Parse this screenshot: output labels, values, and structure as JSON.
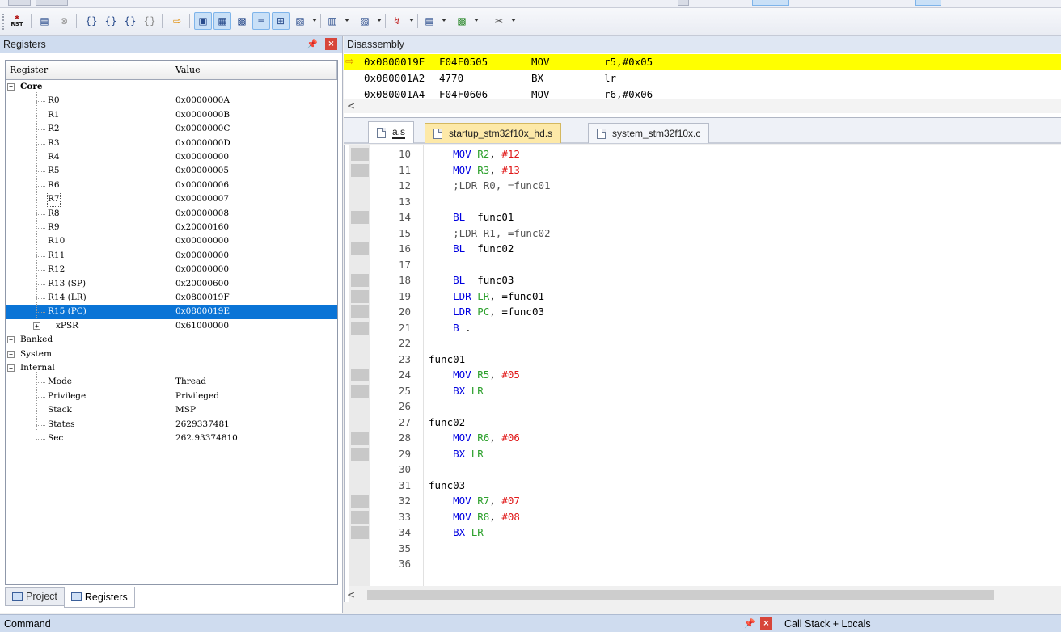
{
  "panels": {
    "registers_title": "Registers",
    "disassembly_title": "Disassembly",
    "command_title": "Command",
    "callstack_title": "Call Stack + Locals"
  },
  "registers": {
    "col_register": "Register",
    "col_value": "Value",
    "rows": [
      {
        "name": "Core",
        "value": "",
        "bold": true
      },
      {
        "name": "R0",
        "value": "0x0000000A"
      },
      {
        "name": "R1",
        "value": "0x0000000B"
      },
      {
        "name": "R2",
        "value": "0x0000000C"
      },
      {
        "name": "R3",
        "value": "0x0000000D"
      },
      {
        "name": "R4",
        "value": "0x00000000"
      },
      {
        "name": "R5",
        "value": "0x00000005"
      },
      {
        "name": "R6",
        "value": "0x00000006"
      },
      {
        "name": "R7",
        "value": "0x00000007",
        "focus": true
      },
      {
        "name": "R8",
        "value": "0x00000008"
      },
      {
        "name": "R9",
        "value": "0x20000160"
      },
      {
        "name": "R10",
        "value": "0x00000000"
      },
      {
        "name": "R11",
        "value": "0x00000000"
      },
      {
        "name": "R12",
        "value": "0x00000000"
      },
      {
        "name": "R13 (SP)",
        "value": "0x20000600"
      },
      {
        "name": "R14 (LR)",
        "value": "0x0800019F"
      },
      {
        "name": "R15 (PC)",
        "value": "0x0800019E",
        "selected": true
      },
      {
        "name": "xPSR",
        "value": "0x61000000",
        "expandable": true
      },
      {
        "name": "Banked",
        "value": "",
        "expandable": true
      },
      {
        "name": "System",
        "value": "",
        "expandable": true
      },
      {
        "name": "Internal",
        "value": "",
        "expanded": true
      },
      {
        "name": "Mode",
        "value": "Thread"
      },
      {
        "name": "Privilege",
        "value": "Privileged"
      },
      {
        "name": "Stack",
        "value": "MSP"
      },
      {
        "name": "States",
        "value": "2629337481"
      },
      {
        "name": "Sec",
        "value": "262.93374810"
      }
    ]
  },
  "bottom_tabs": [
    {
      "label": "Project",
      "active": false
    },
    {
      "label": "Registers",
      "active": true
    }
  ],
  "disassembly": {
    "lines": [
      {
        "addr": "0x0800019E",
        "opcode": "F04F0505",
        "mnem": "MOV",
        "operands": "r5,#0x05",
        "current": true
      },
      {
        "addr": "0x080001A2",
        "opcode": "4770",
        "mnem": "BX",
        "operands": "lr",
        "current": false
      },
      {
        "addr": "0x080001A4",
        "opcode": "F04F0606",
        "mnem": "MOV",
        "operands": "r6,#0x06",
        "current": false
      }
    ]
  },
  "editor_tabs": [
    {
      "label": "a.s",
      "active": true,
      "highlight": false
    },
    {
      "label": "startup_stm32f10x_hd.s",
      "active": false,
      "highlight": true
    },
    {
      "label": "system_stm32f10x.c",
      "active": false,
      "highlight": false
    }
  ],
  "code": {
    "lines": [
      {
        "n": "10",
        "parts": [
          [
            "i",
            "    "
          ],
          [
            "kw",
            "MOV"
          ],
          [
            "i",
            " "
          ],
          [
            "rg",
            "R2"
          ],
          [
            "i",
            ", "
          ],
          [
            "nm",
            "#12"
          ]
        ],
        "bp": true
      },
      {
        "n": "11",
        "parts": [
          [
            "i",
            "    "
          ],
          [
            "kw",
            "MOV"
          ],
          [
            "i",
            " "
          ],
          [
            "rg",
            "R3"
          ],
          [
            "i",
            ", "
          ],
          [
            "nm",
            "#13"
          ]
        ],
        "bp": true
      },
      {
        "n": "12",
        "parts": [
          [
            "i",
            "    "
          ],
          [
            "cm",
            ";LDR R0, =func01"
          ]
        ],
        "bp": false
      },
      {
        "n": "13",
        "parts": [],
        "bp": false
      },
      {
        "n": "14",
        "parts": [
          [
            "i",
            "    "
          ],
          [
            "kw",
            "BL"
          ],
          [
            "lb",
            "  func01"
          ]
        ],
        "bp": true
      },
      {
        "n": "15",
        "parts": [
          [
            "i",
            "    "
          ],
          [
            "cm",
            ";LDR R1, =func02"
          ]
        ],
        "bp": false
      },
      {
        "n": "16",
        "parts": [
          [
            "i",
            "    "
          ],
          [
            "kw",
            "BL"
          ],
          [
            "lb",
            "  func02"
          ]
        ],
        "bp": true
      },
      {
        "n": "17",
        "parts": [],
        "bp": false
      },
      {
        "n": "18",
        "parts": [
          [
            "i",
            "    "
          ],
          [
            "kw",
            "BL"
          ],
          [
            "lb",
            "  func03"
          ]
        ],
        "bp": true
      },
      {
        "n": "19",
        "parts": [
          [
            "i",
            "    "
          ],
          [
            "kw",
            "LDR"
          ],
          [
            "i",
            " "
          ],
          [
            "rg",
            "LR"
          ],
          [
            "lb",
            ", =func01"
          ]
        ],
        "bp": true
      },
      {
        "n": "20",
        "parts": [
          [
            "i",
            "    "
          ],
          [
            "kw",
            "LDR"
          ],
          [
            "i",
            " "
          ],
          [
            "rg",
            "PC"
          ],
          [
            "lb",
            ", =func03"
          ]
        ],
        "bp": true
      },
      {
        "n": "21",
        "parts": [
          [
            "i",
            "    "
          ],
          [
            "kw",
            "B"
          ],
          [
            "lb",
            " ."
          ]
        ],
        "bp": true
      },
      {
        "n": "22",
        "parts": [],
        "bp": false
      },
      {
        "n": "23",
        "parts": [
          [
            "lb",
            "func01"
          ]
        ],
        "bp": false
      },
      {
        "n": "24",
        "parts": [
          [
            "i",
            "    "
          ],
          [
            "kw",
            "MOV"
          ],
          [
            "i",
            " "
          ],
          [
            "rg",
            "R5"
          ],
          [
            "i",
            ", "
          ],
          [
            "nm",
            "#05"
          ]
        ],
        "bp": true
      },
      {
        "n": "25",
        "parts": [
          [
            "i",
            "    "
          ],
          [
            "kw",
            "BX"
          ],
          [
            "i",
            " "
          ],
          [
            "rg",
            "LR"
          ]
        ],
        "bp": true
      },
      {
        "n": "26",
        "parts": [],
        "bp": false
      },
      {
        "n": "27",
        "parts": [
          [
            "lb",
            "func02"
          ]
        ],
        "bp": false
      },
      {
        "n": "28",
        "parts": [
          [
            "i",
            "    "
          ],
          [
            "kw",
            "MOV"
          ],
          [
            "i",
            " "
          ],
          [
            "rg",
            "R6"
          ],
          [
            "i",
            ", "
          ],
          [
            "nm",
            "#06"
          ]
        ],
        "bp": true
      },
      {
        "n": "29",
        "parts": [
          [
            "i",
            "    "
          ],
          [
            "kw",
            "BX"
          ],
          [
            "i",
            " "
          ],
          [
            "rg",
            "LR"
          ]
        ],
        "bp": true
      },
      {
        "n": "30",
        "parts": [],
        "bp": false
      },
      {
        "n": "31",
        "parts": [
          [
            "lb",
            "func03"
          ]
        ],
        "bp": false
      },
      {
        "n": "32",
        "parts": [
          [
            "i",
            "    "
          ],
          [
            "kw",
            "MOV"
          ],
          [
            "i",
            " "
          ],
          [
            "rg",
            "R7"
          ],
          [
            "i",
            ", "
          ],
          [
            "nm",
            "#07"
          ]
        ],
        "bp": true
      },
      {
        "n": "33",
        "parts": [
          [
            "i",
            "    "
          ],
          [
            "kw",
            "MOV"
          ],
          [
            "i",
            " "
          ],
          [
            "rg",
            "R8"
          ],
          [
            "i",
            ", "
          ],
          [
            "nm",
            "#08"
          ]
        ],
        "bp": true
      },
      {
        "n": "34",
        "parts": [
          [
            "i",
            "    "
          ],
          [
            "kw",
            "BX"
          ],
          [
            "i",
            " "
          ],
          [
            "rg",
            "LR"
          ]
        ],
        "bp": true
      },
      {
        "n": "35",
        "parts": [],
        "bp": false
      },
      {
        "n": "36",
        "parts": [],
        "bp": false
      }
    ]
  },
  "toolbar": {
    "reset_label": "RST",
    "items": [
      {
        "icon": "reset-icon"
      },
      {
        "icon": "run-icon"
      },
      {
        "icon": "stop-icon"
      },
      {
        "icon": "step-into-icon"
      },
      {
        "icon": "step-over-icon"
      },
      {
        "icon": "step-out-icon"
      },
      {
        "icon": "run-to-cursor-icon"
      },
      {
        "icon": "show-next-statement-icon"
      },
      {
        "icon": "command-window-icon"
      },
      {
        "icon": "disassembly-window-icon"
      },
      {
        "icon": "symbols-window-icon"
      },
      {
        "icon": "registers-window-icon"
      },
      {
        "icon": "call-stack-window-icon"
      },
      {
        "icon": "watch-window-icon"
      },
      {
        "icon": "memory-window-icon"
      },
      {
        "icon": "serial-window-icon"
      },
      {
        "icon": "analysis-window-icon"
      },
      {
        "icon": "trace-window-icon"
      },
      {
        "icon": "system-viewer-icon"
      },
      {
        "icon": "toolbox-icon"
      }
    ]
  },
  "colors": {
    "current_line": "#ffff00",
    "selection": "#0a74d6",
    "keyword": "#0000e0",
    "register": "#2ca02c",
    "number": "#e01818"
  }
}
